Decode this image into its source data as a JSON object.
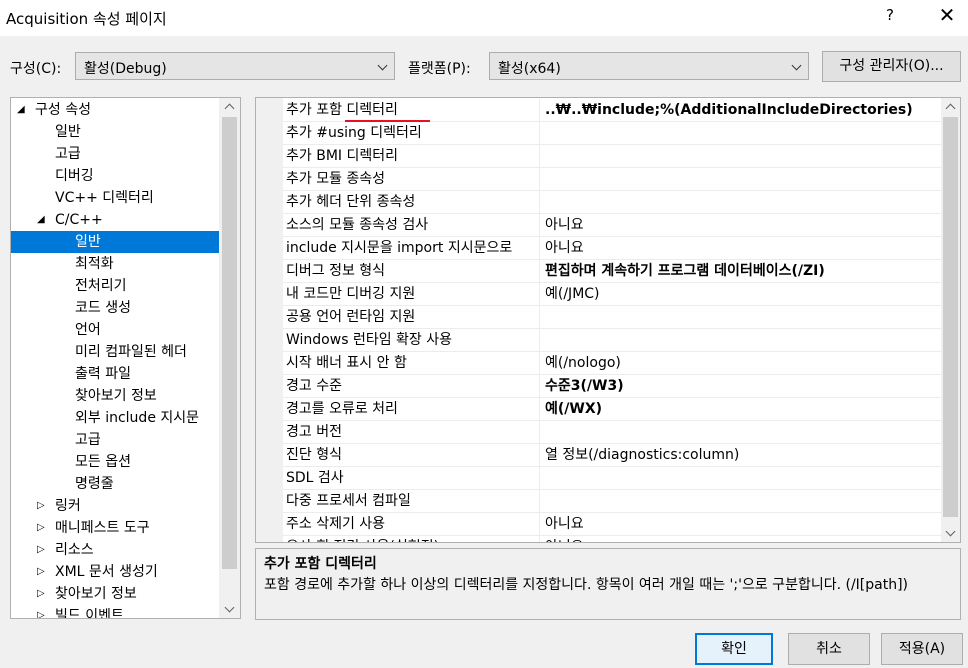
{
  "window": {
    "title": "Acquisition 속성 페이지",
    "help": "?",
    "close": "✕"
  },
  "toolbar": {
    "config_label": "구성(C):",
    "config_value": "활성(Debug)",
    "platform_label": "플랫폼(P):",
    "platform_value": "활성(x64)",
    "config_manager": "구성 관리자(O)..."
  },
  "tree": {
    "items": [
      {
        "label": "구성 속성",
        "level": 0,
        "expander": "◢",
        "selected": false
      },
      {
        "label": "일반",
        "level": 1,
        "expander": "",
        "selected": false
      },
      {
        "label": "고급",
        "level": 1,
        "expander": "",
        "selected": false
      },
      {
        "label": "디버깅",
        "level": 1,
        "expander": "",
        "selected": false
      },
      {
        "label": "VC++ 디렉터리",
        "level": 1,
        "expander": "",
        "selected": false
      },
      {
        "label": "C/C++",
        "level": 1,
        "expander": "◢",
        "selected": false
      },
      {
        "label": "일반",
        "level": 2,
        "expander": "",
        "selected": true
      },
      {
        "label": "최적화",
        "level": 2,
        "expander": "",
        "selected": false
      },
      {
        "label": "전처리기",
        "level": 2,
        "expander": "",
        "selected": false
      },
      {
        "label": "코드 생성",
        "level": 2,
        "expander": "",
        "selected": false
      },
      {
        "label": "언어",
        "level": 2,
        "expander": "",
        "selected": false
      },
      {
        "label": "미리 컴파일된 헤더",
        "level": 2,
        "expander": "",
        "selected": false
      },
      {
        "label": "출력 파일",
        "level": 2,
        "expander": "",
        "selected": false
      },
      {
        "label": "찾아보기 정보",
        "level": 2,
        "expander": "",
        "selected": false
      },
      {
        "label": "외부 include 지시문",
        "level": 2,
        "expander": "",
        "selected": false
      },
      {
        "label": "고급",
        "level": 2,
        "expander": "",
        "selected": false
      },
      {
        "label": "모든 옵션",
        "level": 2,
        "expander": "",
        "selected": false
      },
      {
        "label": "명령줄",
        "level": 2,
        "expander": "",
        "selected": false
      },
      {
        "label": "링커",
        "level": 1,
        "expander": "▷",
        "selected": false
      },
      {
        "label": "매니페스트 도구",
        "level": 1,
        "expander": "▷",
        "selected": false
      },
      {
        "label": "리소스",
        "level": 1,
        "expander": "▷",
        "selected": false
      },
      {
        "label": "XML 문서 생성기",
        "level": 1,
        "expander": "▷",
        "selected": false
      },
      {
        "label": "찾아보기 정보",
        "level": 1,
        "expander": "▷",
        "selected": false
      },
      {
        "label": "빌드 이벤트",
        "level": 1,
        "expander": "▷",
        "selected": false
      }
    ]
  },
  "grid": {
    "rows": [
      {
        "name": "추가 포함 디렉터리",
        "value": "..₩..₩include;%(AdditionalIncludeDirectories)",
        "bold": true
      },
      {
        "name": "추가 #using 디렉터리",
        "value": "",
        "bold": false
      },
      {
        "name": "추가 BMI 디렉터리",
        "value": "",
        "bold": false
      },
      {
        "name": "추가 모듈 종속성",
        "value": "",
        "bold": false
      },
      {
        "name": "추가 헤더 단위 종속성",
        "value": "",
        "bold": false
      },
      {
        "name": "소스의 모듈 종속성 검사",
        "value": "아니요",
        "bold": false
      },
      {
        "name": "include 지시문을 import 지시문으로",
        "value": "아니요",
        "bold": false
      },
      {
        "name": "디버그 정보 형식",
        "value": "편집하며 계속하기 프로그램 데이터베이스(/ZI)",
        "bold": true
      },
      {
        "name": "내 코드만 디버깅 지원",
        "value": "예(/JMC)",
        "bold": false
      },
      {
        "name": "공용 언어 런타임 지원",
        "value": "",
        "bold": false
      },
      {
        "name": "Windows 런타임 확장 사용",
        "value": "",
        "bold": false
      },
      {
        "name": "시작 배너 표시 안 함",
        "value": "예(/nologo)",
        "bold": false
      },
      {
        "name": "경고 수준",
        "value": "수준3(/W3)",
        "bold": true
      },
      {
        "name": "경고를 오류로 처리",
        "value": "예(/WX)",
        "bold": true
      },
      {
        "name": "경고 버전",
        "value": "",
        "bold": false
      },
      {
        "name": "진단 형식",
        "value": "열 정보(/diagnostics:column)",
        "bold": false
      },
      {
        "name": "SDL 검사",
        "value": "",
        "bold": false
      },
      {
        "name": "다중 프로세서 컴파일",
        "value": "",
        "bold": false
      },
      {
        "name": "주소 삭제기 사용",
        "value": "아니요",
        "bold": false
      },
      {
        "name": "유사 힙 정리 사용(실험적)",
        "value": "아니요",
        "bold": false
      }
    ]
  },
  "description": {
    "title": "추가 포함 디렉터리",
    "text": "포함 경로에 추가할 하나 이상의 디렉터리를 지정합니다. 항목이 여러 개일 때는 ';'으로 구분합니다. (/I[path])"
  },
  "buttons": {
    "ok": "확인",
    "cancel": "취소",
    "apply": "적용(A)"
  }
}
